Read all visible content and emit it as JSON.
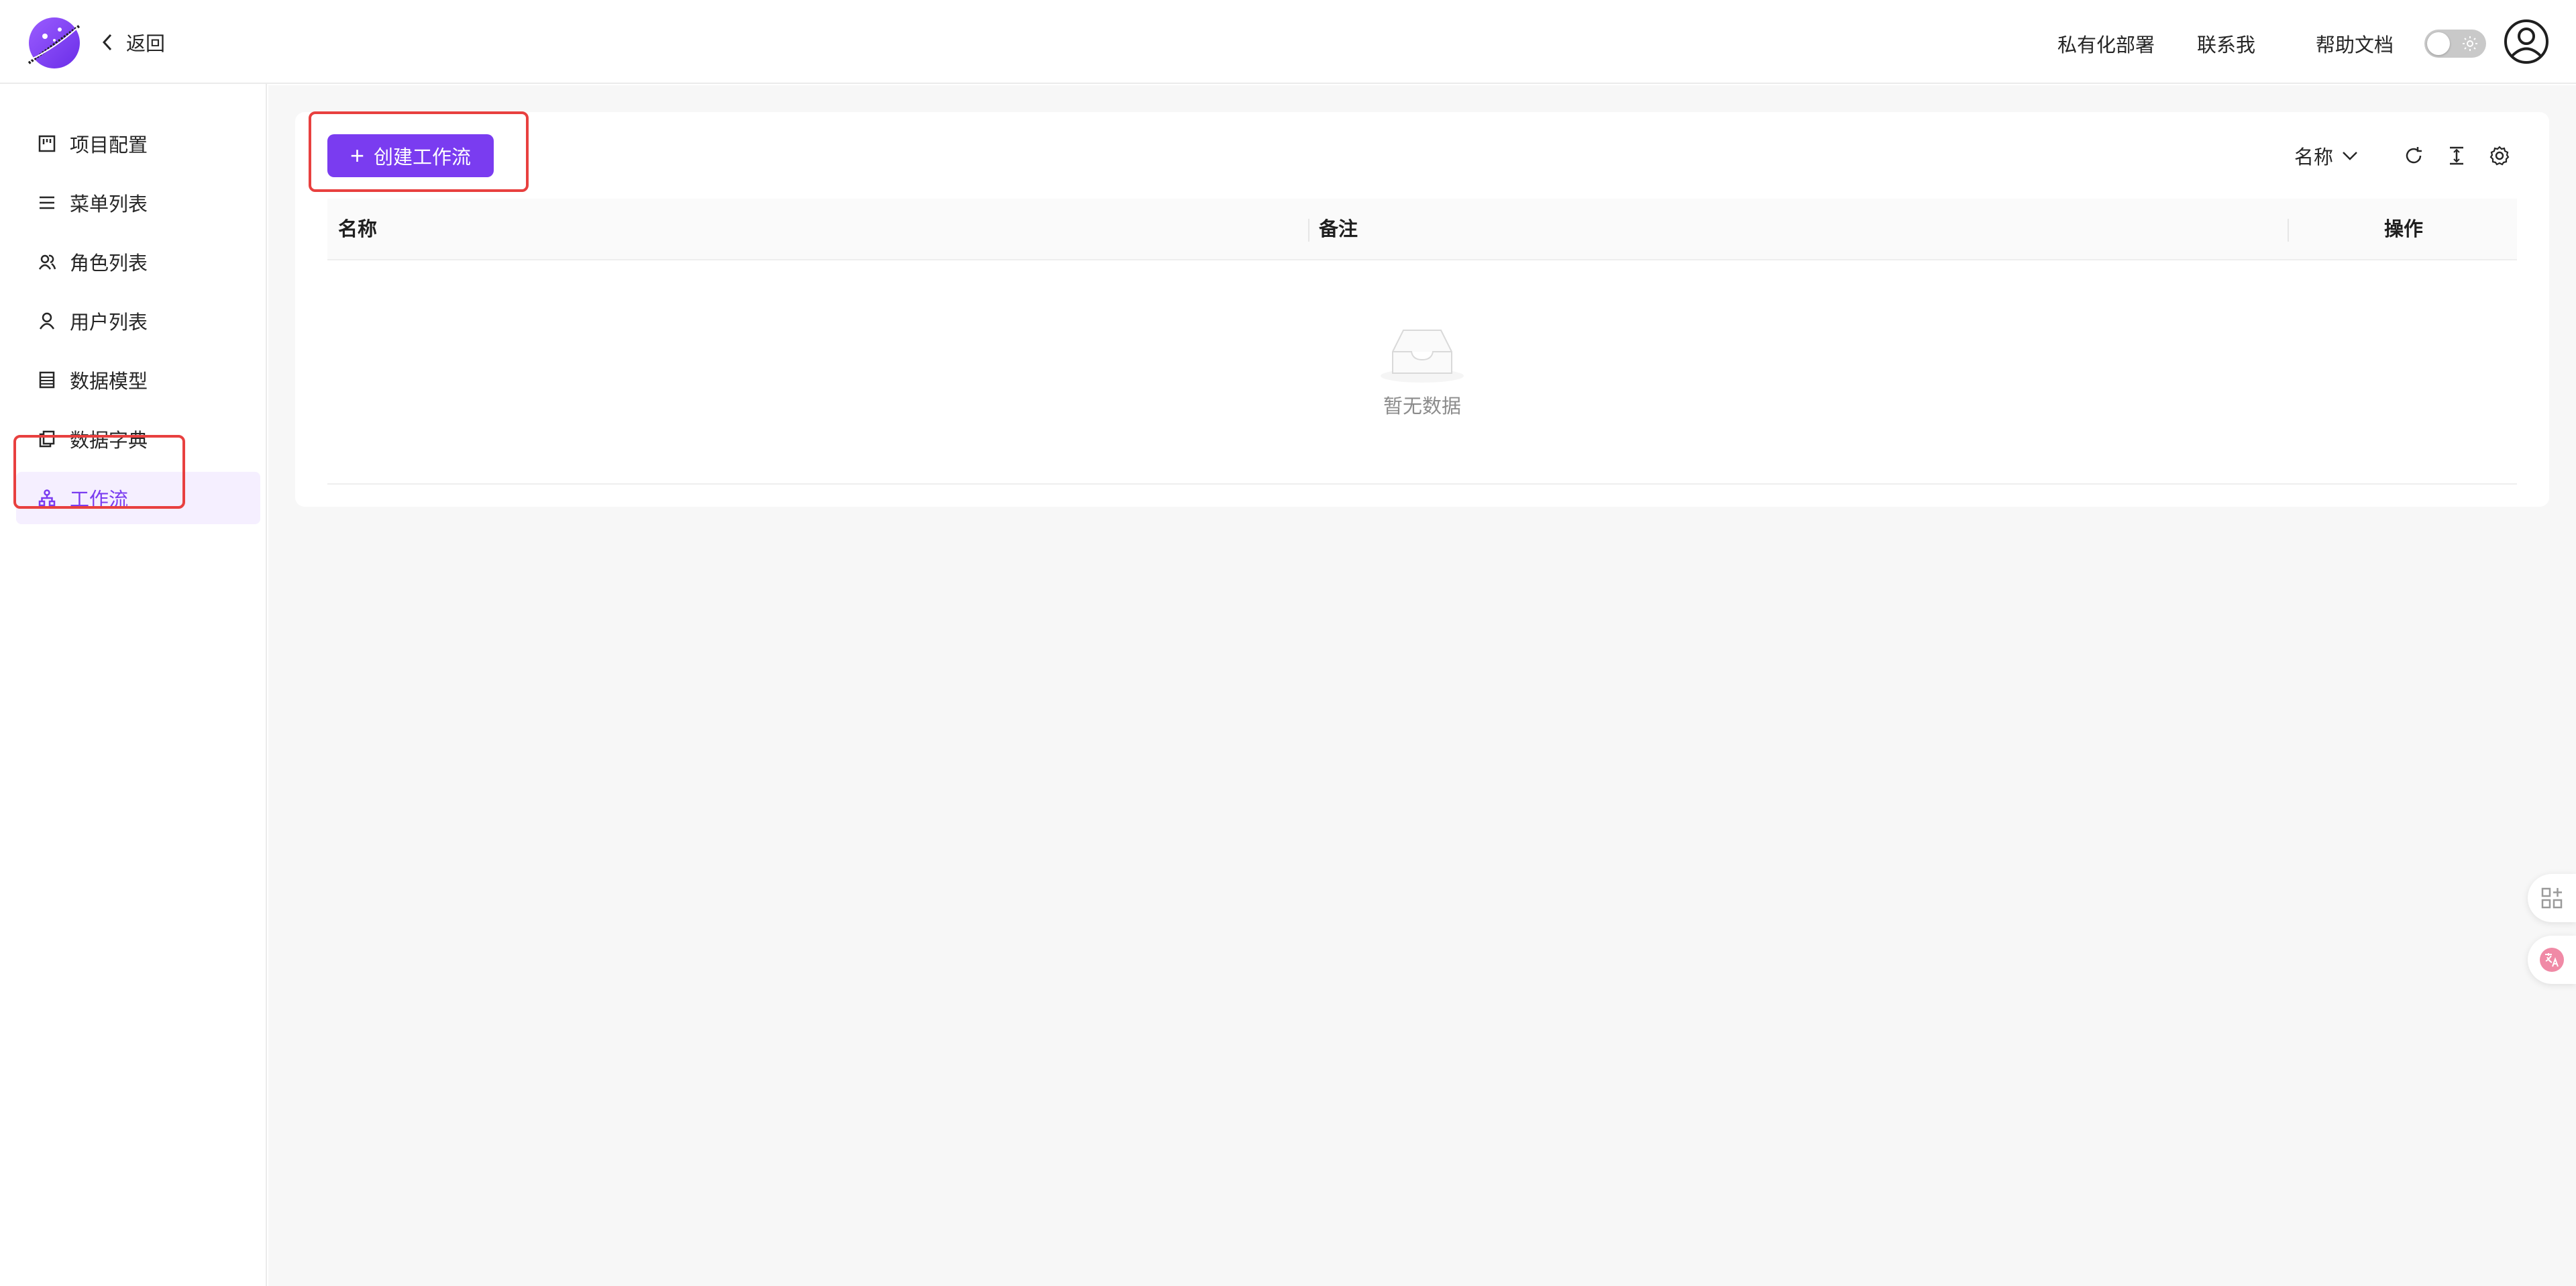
{
  "header": {
    "back_label": "返回",
    "links": [
      "私有化部署",
      "联系我",
      "帮助文档"
    ],
    "theme_toggle_state": "off"
  },
  "sidebar": {
    "items": [
      {
        "label": "项目配置",
        "icon": "project-config-icon"
      },
      {
        "label": "菜单列表",
        "icon": "menu-list-icon"
      },
      {
        "label": "角色列表",
        "icon": "role-list-icon"
      },
      {
        "label": "用户列表",
        "icon": "user-icon"
      },
      {
        "label": "数据模型",
        "icon": "data-model-icon"
      },
      {
        "label": "数据字典",
        "icon": "data-dictionary-icon"
      },
      {
        "label": "工作流",
        "icon": "workflow-icon"
      }
    ],
    "active_index": 6
  },
  "toolbar": {
    "create_label": "创建工作流",
    "sort_label": "名称"
  },
  "table": {
    "columns": [
      "名称",
      "备注",
      "操作"
    ],
    "rows": [],
    "empty_text": "暂无数据"
  },
  "colors": {
    "accent": "#7a3cf0",
    "active_bg": "#f5efff",
    "annotation": "#e8403f"
  }
}
